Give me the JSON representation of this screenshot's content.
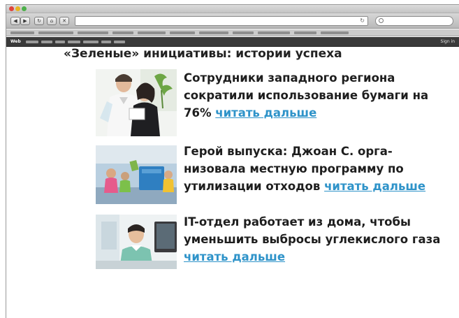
{
  "browser": {
    "nav_back": "◀",
    "nav_forward": "▶",
    "reload_icon": "↻",
    "home_icon": "⌂",
    "stop_icon": "✕",
    "go_icon": "↻"
  },
  "site_nav": {
    "logo": "Web",
    "signin": "Sign in"
  },
  "page": {
    "heading": "«Зеленые» инициативы: истории успеха",
    "stories": [
      {
        "text": "Сотрудники западного региона сократили использование бумаги на 76%",
        "link": "читать дальше",
        "image": "office-workers-photo"
      },
      {
        "text": "Герой выпуска: Джоан С. орга-низовала местную программу по утилизации отходов",
        "link": "читать дальше",
        "image": "recycling-kids-photo"
      },
      {
        "text": "IT-отдел работает из дома, чтобы уменьшить выбросы углекислого газа",
        "link": "читать дальше",
        "image": "remote-worker-photo"
      }
    ]
  },
  "colors": {
    "link": "#2e93c9",
    "text": "#1e1e1e",
    "site_bar": "#3a3a3a"
  }
}
